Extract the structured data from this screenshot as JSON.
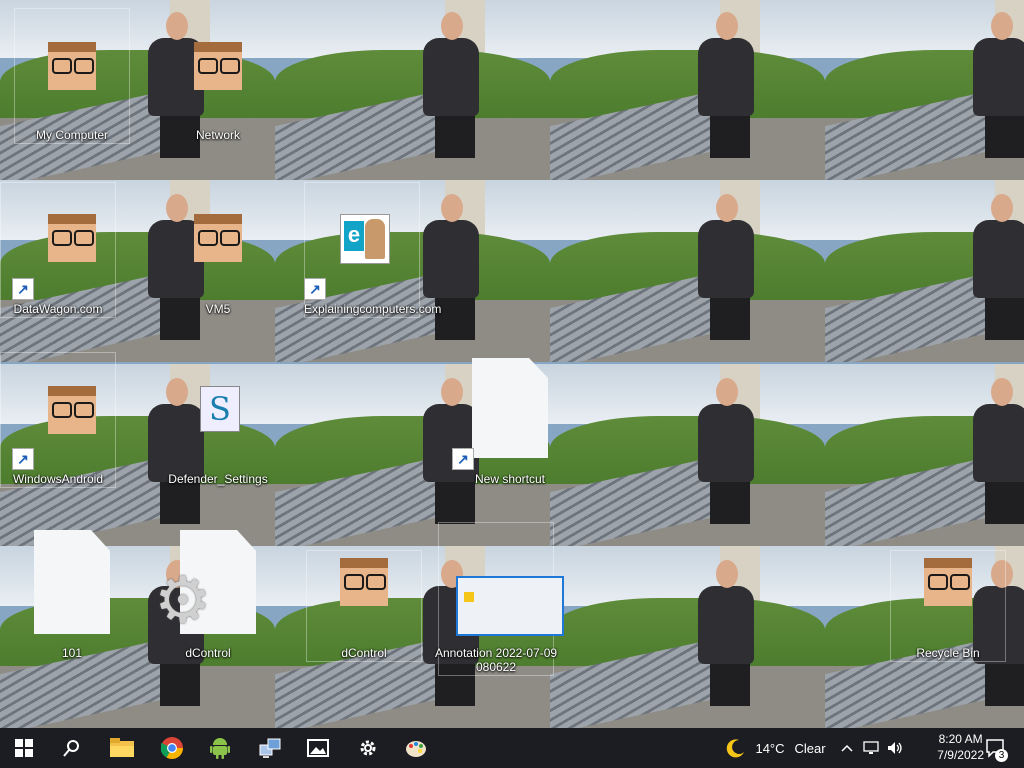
{
  "desktop": {
    "icons": [
      {
        "label": "My Computer"
      },
      {
        "label": "Network"
      },
      {
        "label": "DataWagon.com"
      },
      {
        "label": "VM5"
      },
      {
        "label": "Explainingcomputers.com"
      },
      {
        "label": "WindowsAndroid"
      },
      {
        "label": "Defender_Settings"
      },
      {
        "label": "New shortcut"
      },
      {
        "label": "101"
      },
      {
        "label": "dControl"
      },
      {
        "label": "dControl"
      },
      {
        "label": "Annotation 2022-07-09 080622"
      },
      {
        "label": "Recycle Bin"
      }
    ],
    "e_logo_letter": "e",
    "s_glyph": "S",
    "shortcut_arrow": "↗"
  },
  "taskbar": {
    "start_icon": "windows-logo-icon",
    "search_icon": "search-icon",
    "pinned": [
      {
        "name": "file-explorer-icon"
      },
      {
        "name": "chrome-icon"
      },
      {
        "name": "android-icon"
      },
      {
        "name": "network-app-icon"
      },
      {
        "name": "photos-icon"
      },
      {
        "name": "settings-icon"
      },
      {
        "name": "paint-icon"
      }
    ],
    "weather": {
      "temp": "14°C",
      "condition": "Clear"
    },
    "clock": {
      "time": "8:20 AM",
      "date": "7/9/2022"
    },
    "notification_count": "3",
    "colors": {
      "bg": "#1c1d22",
      "accent": "#0078d7"
    }
  }
}
